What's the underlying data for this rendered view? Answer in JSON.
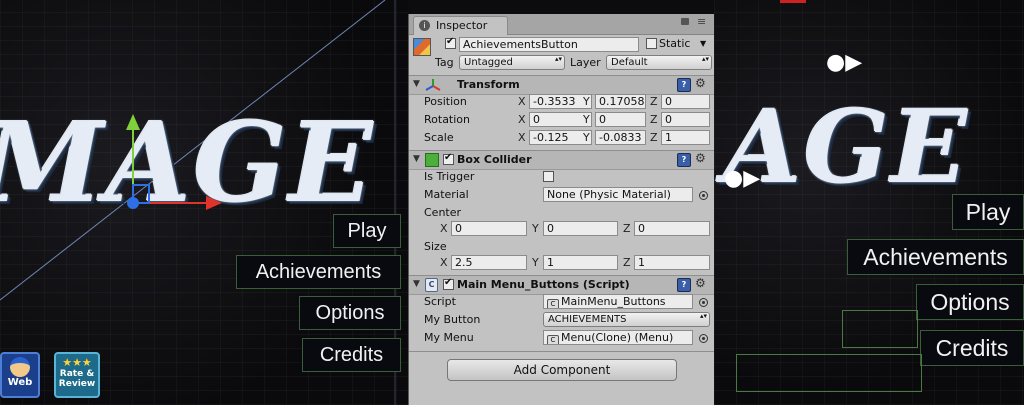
{
  "scene_left": {
    "logo": "MAGE",
    "menu_buttons": [
      "Play",
      "Achievements",
      "Options",
      "Credits"
    ],
    "web_badge": "Web",
    "rate_badge": "Rate & Review"
  },
  "scene_right": {
    "logo": "AGE",
    "menu_buttons": [
      "Play",
      "Achievements",
      "Options",
      "Credits"
    ]
  },
  "inspector": {
    "tab_label": "Inspector",
    "object": {
      "active": true,
      "name": "AchievementsButton",
      "static_label": "Static",
      "static": false,
      "tag_label": "Tag",
      "tag_value": "Untagged",
      "layer_label": "Layer",
      "layer_value": "Default"
    },
    "transform": {
      "title": "Transform",
      "position_label": "Position",
      "rotation_label": "Rotation",
      "scale_label": "Scale",
      "position": {
        "x": "-0.3533",
        "y": "0.17058",
        "z": "0"
      },
      "rotation": {
        "x": "0",
        "y": "0",
        "z": "0"
      },
      "scale": {
        "x": "-0.125",
        "y": "-0.0833",
        "z": "1"
      }
    },
    "box_collider": {
      "title": "Box Collider",
      "enabled": true,
      "is_trigger_label": "Is Trigger",
      "is_trigger": false,
      "material_label": "Material",
      "material_value": "None (Physic Material)",
      "center_label": "Center",
      "center": {
        "x": "0",
        "y": "0",
        "z": "0"
      },
      "size_label": "Size",
      "size": {
        "x": "2.5",
        "y": "1",
        "z": "1"
      }
    },
    "script_component": {
      "title": "Main Menu_Buttons (Script)",
      "enabled": true,
      "script_label": "Script",
      "script_value": "MainMenu_Buttons",
      "my_button_label": "My Button",
      "my_button_value": "ACHIEVEMENTS",
      "my_menu_label": "My Menu",
      "my_menu_value": "Menu(Clone) (Menu)"
    },
    "add_component_label": "Add Component"
  },
  "colors": {
    "inspector_bg": "#c2c2c2",
    "button_border": "#3b5e3a",
    "gizmo_x": "#e0332b",
    "gizmo_y": "#7fd13b",
    "gizmo_z": "#2f6fe6"
  }
}
